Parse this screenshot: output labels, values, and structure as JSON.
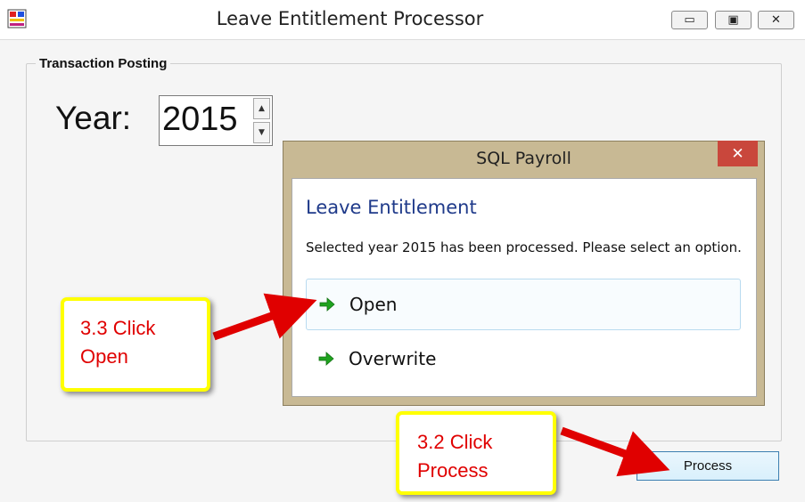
{
  "window": {
    "title": "Leave Entitlement Processor",
    "minimize_glyph": "▭",
    "maximize_glyph": "▣",
    "close_glyph": "✕"
  },
  "form": {
    "group_label": "Transaction Posting",
    "year_label": "Year:",
    "year_value": "2015",
    "spin_up": "▲",
    "spin_down": "▼",
    "process_button": "Process"
  },
  "dialog": {
    "title": "SQL Payroll",
    "close_glyph": "✕",
    "heading": "Leave Entitlement",
    "message": "Selected year 2015 has been processed. Please select an option.",
    "options": [
      {
        "label": "Open",
        "icon": "green-arrow-icon"
      },
      {
        "label": "Overwrite",
        "icon": "green-arrow-icon"
      }
    ]
  },
  "annotations": {
    "open_callout": {
      "line1": "3.3 Click",
      "line2": "Open"
    },
    "process_callout": {
      "line1": "3.2 Click",
      "line2": "Process"
    }
  },
  "colors": {
    "dialog_frame": "#c8b994",
    "close_red": "#c9473c",
    "heading_blue": "#1f3a8a",
    "callout_border": "#ffff00",
    "callout_text": "#e00000",
    "arrow_green": "#1fa31f"
  }
}
